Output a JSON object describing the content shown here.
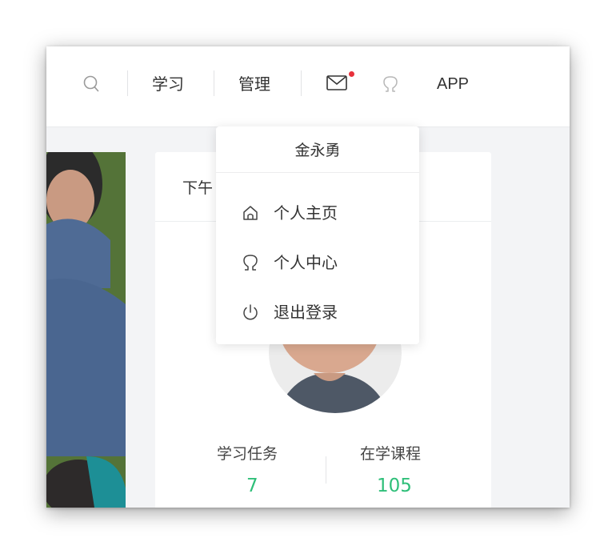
{
  "header": {
    "nav": {
      "study": "学习",
      "manage": "管理",
      "app": "APP"
    },
    "icons": [
      "search-icon",
      "mail-icon",
      "user-icon"
    ],
    "notification_color": "#e8313b"
  },
  "dropdown": {
    "username": "金永勇",
    "items": [
      {
        "label": "个人主页",
        "icon": "home-icon"
      },
      {
        "label": "个人中心",
        "icon": "user-icon"
      },
      {
        "label": "退出登录",
        "icon": "power-icon"
      }
    ]
  },
  "card": {
    "greeting": "下午",
    "stats": [
      {
        "label": "学习任务",
        "value": "7"
      },
      {
        "label": "在学课程",
        "value": "105"
      }
    ],
    "accent": "#2fbf79"
  }
}
